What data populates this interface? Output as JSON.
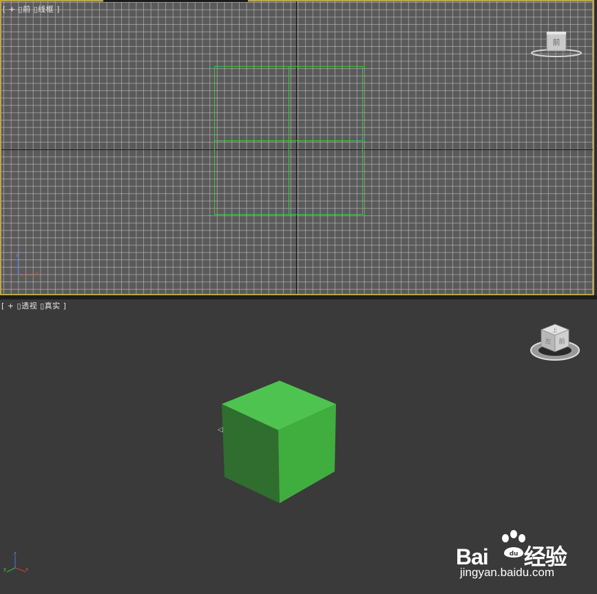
{
  "viewports": {
    "front": {
      "label": {
        "bracket_open": "[",
        "plus": "+",
        "view": "前",
        "shading": "线框",
        "bracket_close": "]"
      },
      "viewcube_face": "前",
      "gizmo_axes": [
        "z",
        "x"
      ]
    },
    "perspective": {
      "label": {
        "bracket_open": "[",
        "plus": "+",
        "view": "透视",
        "shading": "真实",
        "bracket_close": "]"
      },
      "viewcube_faces": [
        "上",
        "左",
        "前"
      ],
      "gizmo_axes": [
        "z",
        "y",
        "x"
      ]
    }
  },
  "object": {
    "name": "box",
    "color_top": "#4fc34f",
    "color_front": "#2f6e2f",
    "color_right": "#3fae3f",
    "wire_color": "#3ec63e"
  },
  "watermark": {
    "brand_left": "Bai",
    "brand_right": "经验",
    "url": "jingyan.baidu.com"
  },
  "colors": {
    "active_border": "#bfa74a",
    "grid_bg": "#5a5a5a",
    "persp_bg": "#3a3a3a"
  }
}
